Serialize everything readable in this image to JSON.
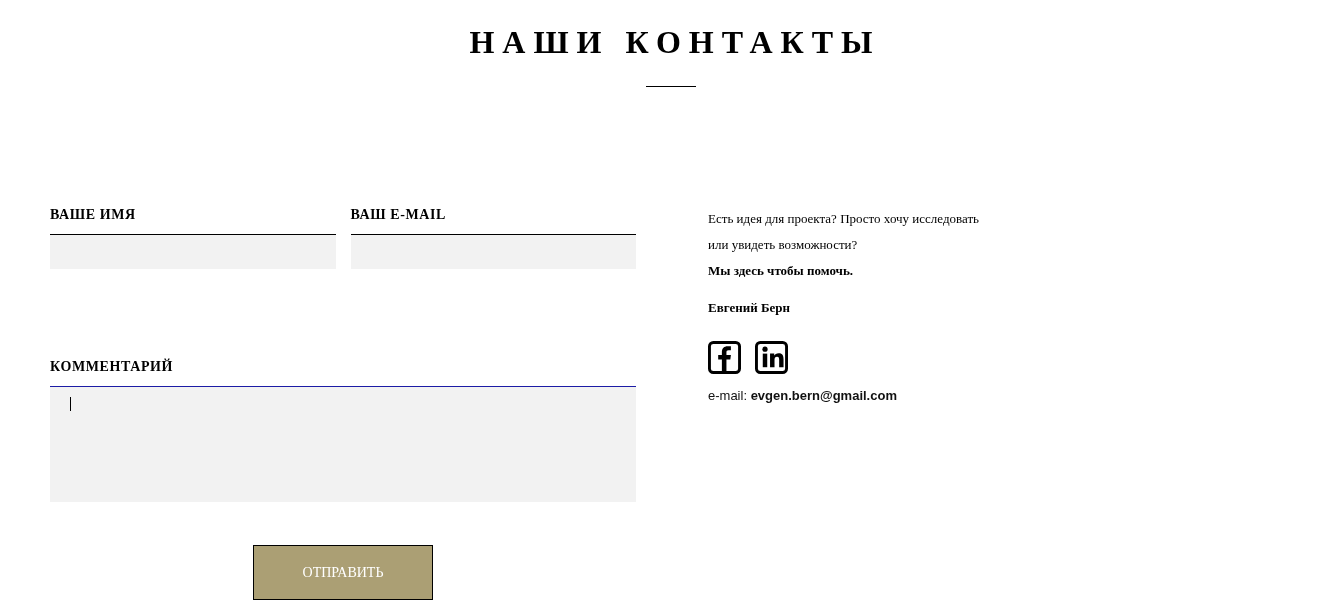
{
  "heading": {
    "title": "НАШИ КОНТАКТЫ"
  },
  "form": {
    "fields": [
      {
        "label": "ВАШЕ ИМЯ",
        "kind": "line",
        "focused": false
      },
      {
        "label": "ВАШ E-MAIL",
        "kind": "line",
        "focused": false
      },
      {
        "label": "КОММЕНТАРИЙ",
        "kind": "area",
        "focused": true
      }
    ],
    "submit": {
      "label": "ОТПРАВИТЬ"
    }
  },
  "contact": {
    "intro": "Есть идея для проекта? Просто хочу исследовать или увидеть возможности?",
    "tagline": "Мы здесь чтобы помочь.",
    "name": "Евгений Берн",
    "email": "e-mail: **evgen.bern@gmail.com**"
  }
}
